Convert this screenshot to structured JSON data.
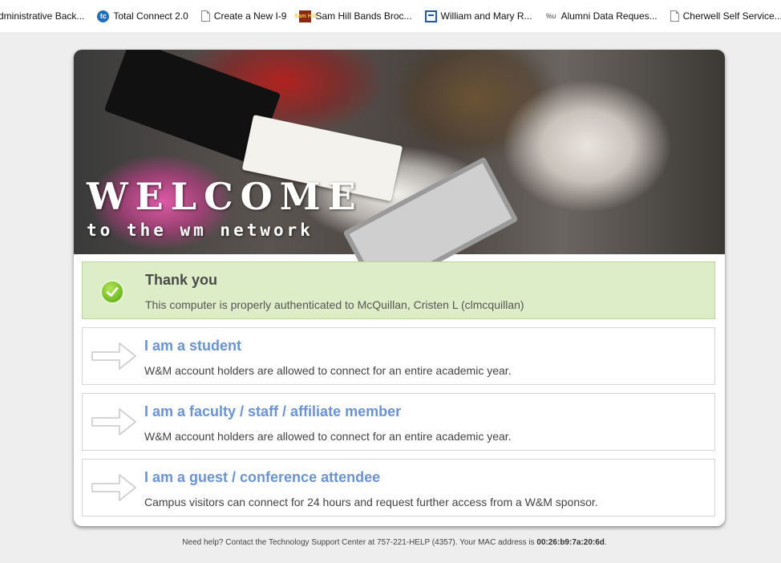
{
  "bookmarks": [
    {
      "label": "dministrative Back...",
      "icon": "none"
    },
    {
      "label": "Total Connect 2.0",
      "icon": "tc-icon"
    },
    {
      "label": "Create a New I-9",
      "icon": "page-icon"
    },
    {
      "label": "Sam Hill Bands Broc...",
      "icon": "sam-hill-icon"
    },
    {
      "label": "William and Mary R...",
      "icon": "window-icon"
    },
    {
      "label": "Alumni Data Reques...",
      "icon": "alumni-icon"
    },
    {
      "label": "Cherwell Self Service...",
      "icon": "page-icon"
    }
  ],
  "bookmark_icon_text": {
    "tc": "tc",
    "sam": "Sam Hill",
    "alumni": "%u"
  },
  "hero": {
    "welcome": "WELCOME",
    "subtitle": "to the wm network"
  },
  "auth": {
    "title": "Thank you",
    "message": "This computer is properly authenticated to McQuillan, Cristen L (clmcquillan)"
  },
  "options": [
    {
      "title": "I am a student",
      "description": "W&M account holders are allowed to connect for an entire academic year."
    },
    {
      "title": "I am a faculty / staff / affiliate member",
      "description": "W&M account holders are allowed to connect for an entire academic year."
    },
    {
      "title": "I am a guest / conference attendee",
      "description": "Campus visitors can connect for 24 hours and request further access from a W&M sponsor."
    }
  ],
  "footer": {
    "help_text": "Need help? Contact the Technology Support Center at 757-221-HELP (4357). Your MAC address is ",
    "mac_address": "00:26:b9:7a:20:6d",
    "suffix": "."
  },
  "colors": {
    "link_blue": "#6a93d6",
    "success_bg": "#dcedc8",
    "check_green": "#7cc22a"
  }
}
